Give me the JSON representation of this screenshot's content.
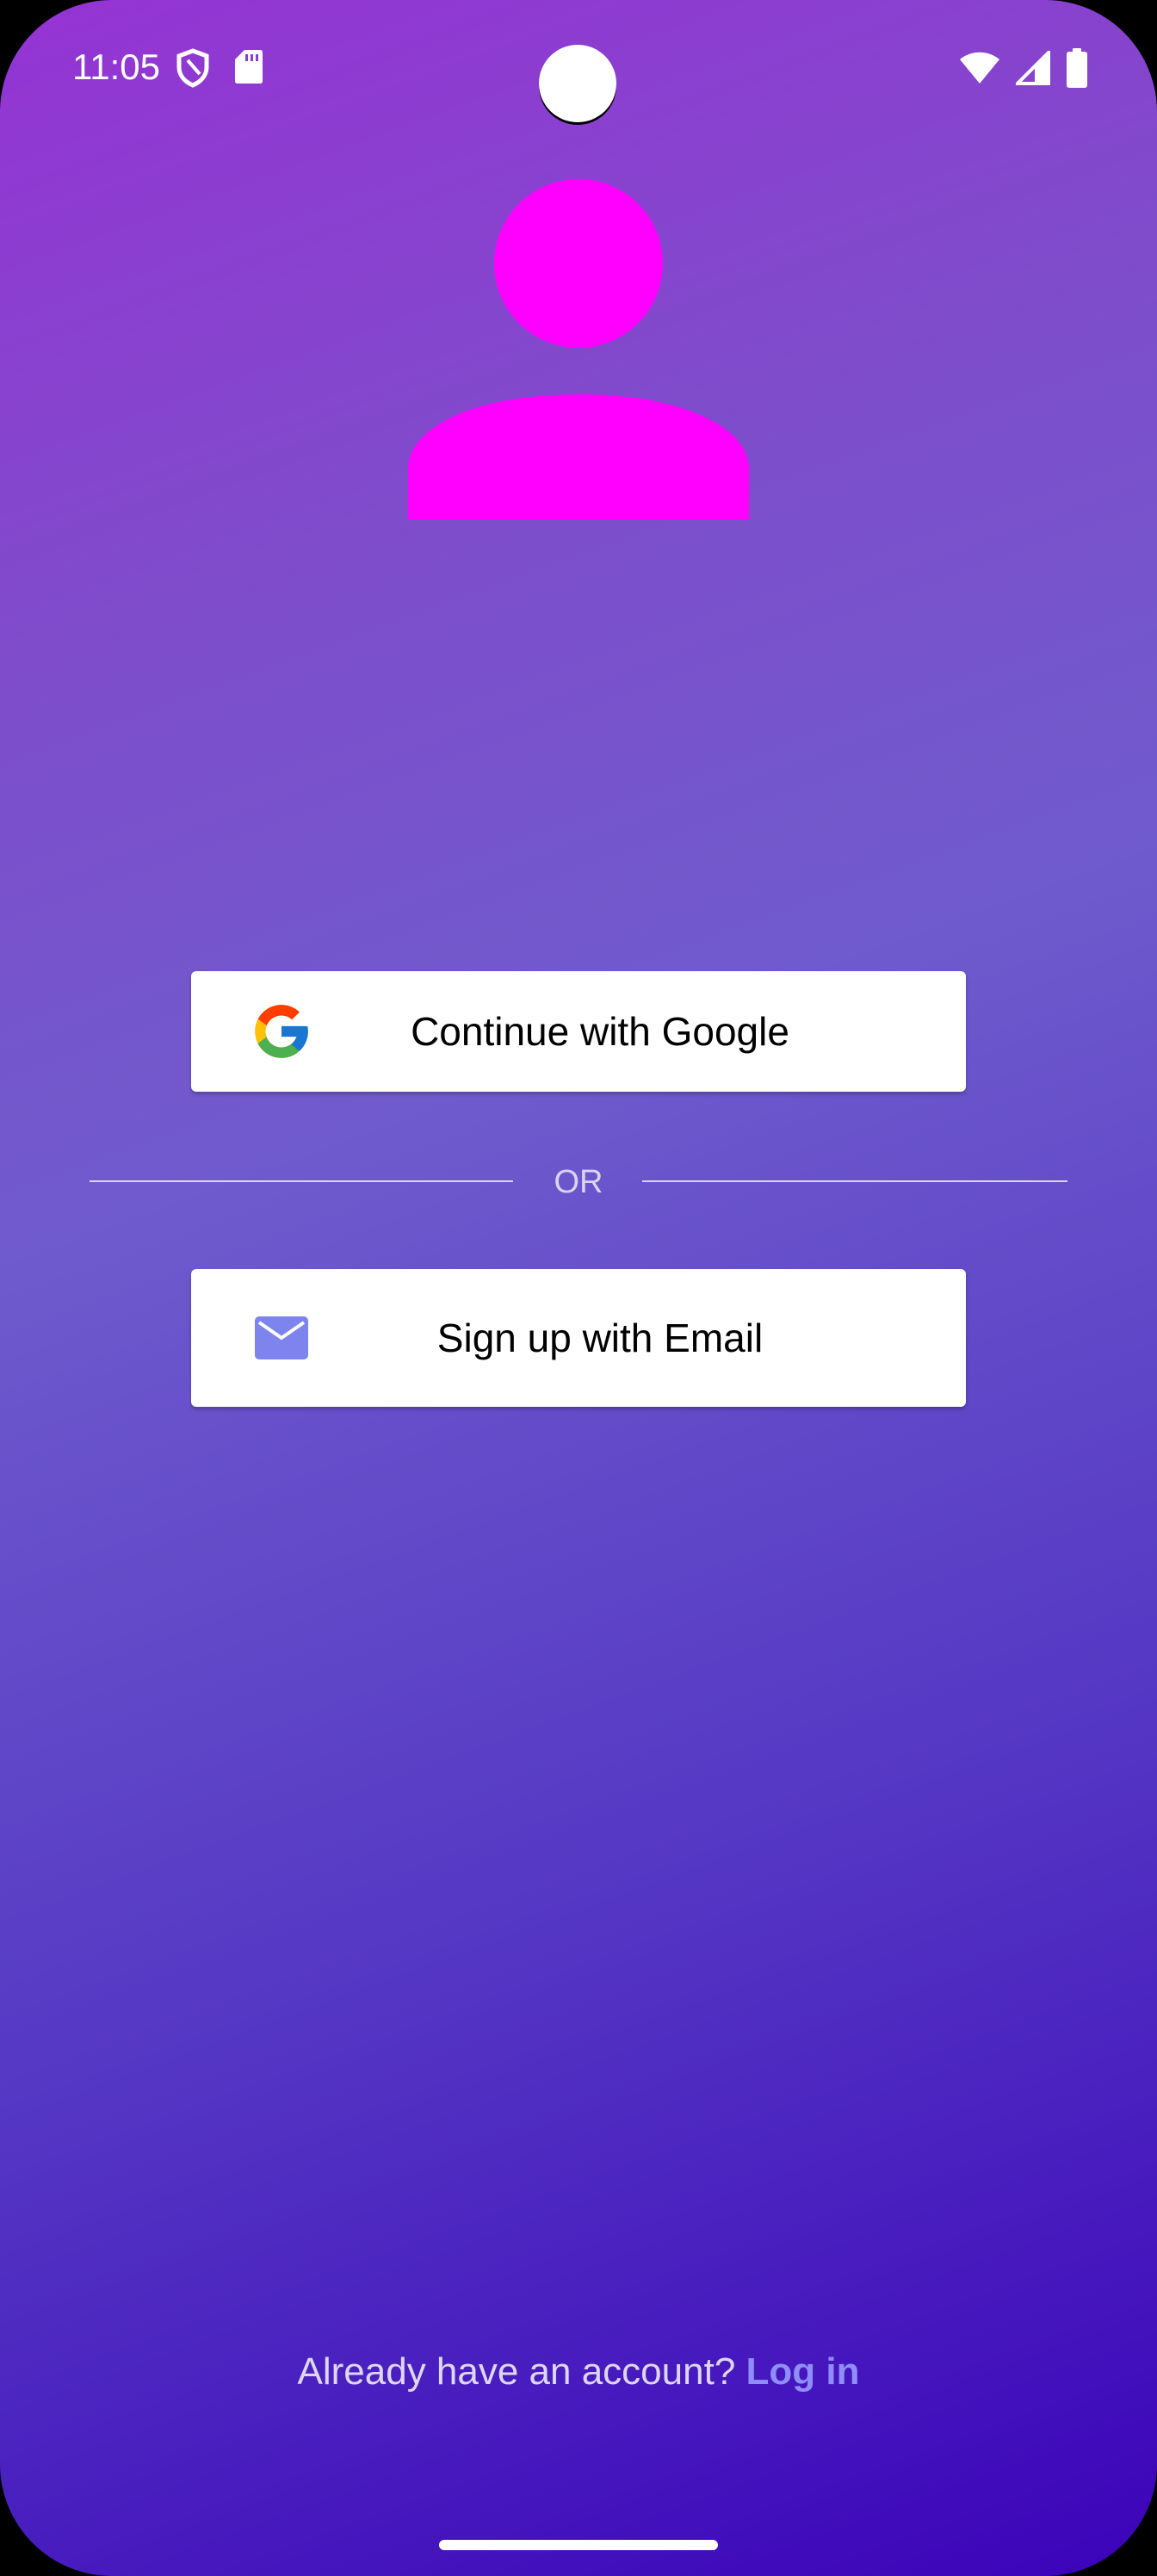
{
  "status_bar": {
    "time": "11:05",
    "left_icons": [
      "shield-icon",
      "sd-card-icon"
    ],
    "right_icons": [
      "wifi-icon",
      "signal-icon",
      "battery-icon"
    ]
  },
  "avatar": {
    "icon": "person-icon",
    "color": "#ff00ff"
  },
  "google_button": {
    "label": "Continue with Google",
    "icon": "google-g-icon"
  },
  "divider": {
    "text": "OR"
  },
  "email_button": {
    "label": "Sign up with Email",
    "icon": "mail-icon",
    "icon_color": "#7d84ee"
  },
  "footer": {
    "prompt": "Already have an account? ",
    "link_label": "Log in",
    "link_color": "#8f8df7"
  },
  "colors": {
    "gradient_top": "#9533d4",
    "gradient_bottom": "#3c03b9"
  }
}
